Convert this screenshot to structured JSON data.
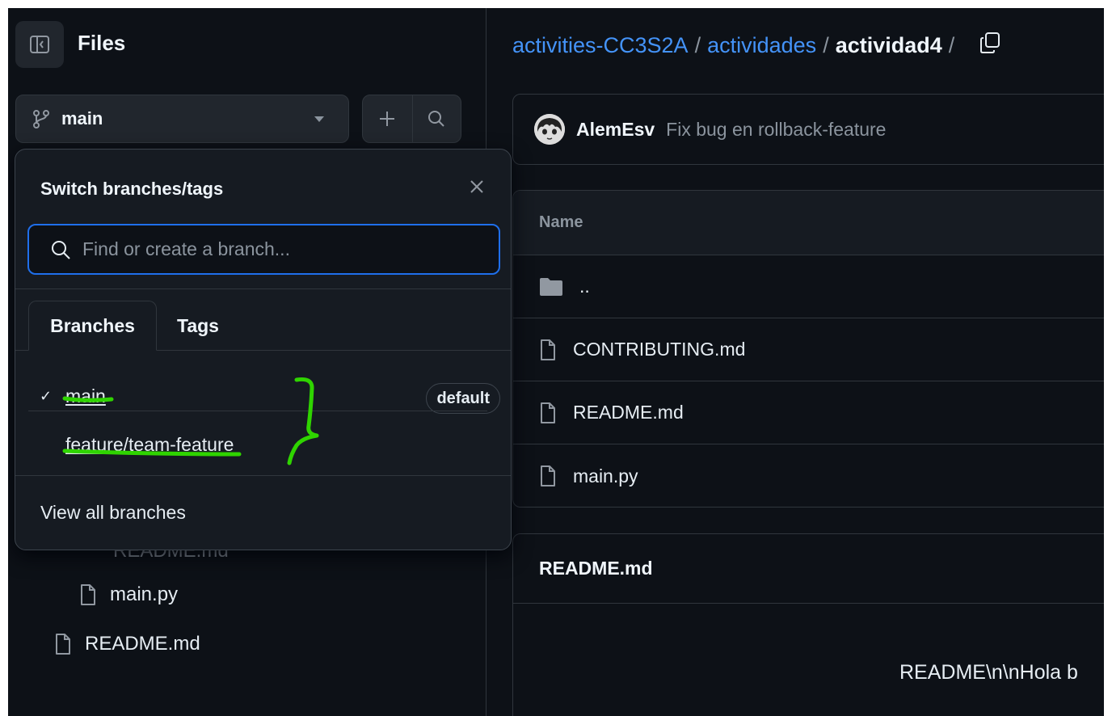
{
  "sidebar": {
    "title": "Files",
    "branch_button_label": "main",
    "tree": [
      {
        "label": "README.md",
        "partial": true
      },
      {
        "label": "main.py"
      },
      {
        "label": "README.md"
      }
    ]
  },
  "dropdown": {
    "title": "Switch branches/tags",
    "search_placeholder": "Find or create a branch...",
    "tabs": [
      "Branches",
      "Tags"
    ],
    "branches": [
      {
        "name": "main",
        "checked": true,
        "badge": "default"
      },
      {
        "name": "feature/team-feature"
      }
    ],
    "view_all_label": "View all branches"
  },
  "breadcrumb": {
    "repo": "activities-CC3S2A",
    "folder": "actividades",
    "current": "actividad4",
    "sep": "/"
  },
  "commit": {
    "author": "AlemEsv",
    "message": "Fix bug en rollback-feature"
  },
  "file_table": {
    "header": "Name",
    "rows": [
      {
        "name": "..",
        "type": "folder"
      },
      {
        "name": "CONTRIBUTING.md",
        "type": "file"
      },
      {
        "name": "README.md",
        "type": "file"
      },
      {
        "name": "main.py",
        "type": "file"
      }
    ]
  },
  "readme": {
    "title": "README.md",
    "content": "README\\n\\nHola b"
  },
  "colors": {
    "background": "#0d1117",
    "link": "#4493f8",
    "focus": "#1f6feb",
    "annotation": "#2fd400"
  }
}
